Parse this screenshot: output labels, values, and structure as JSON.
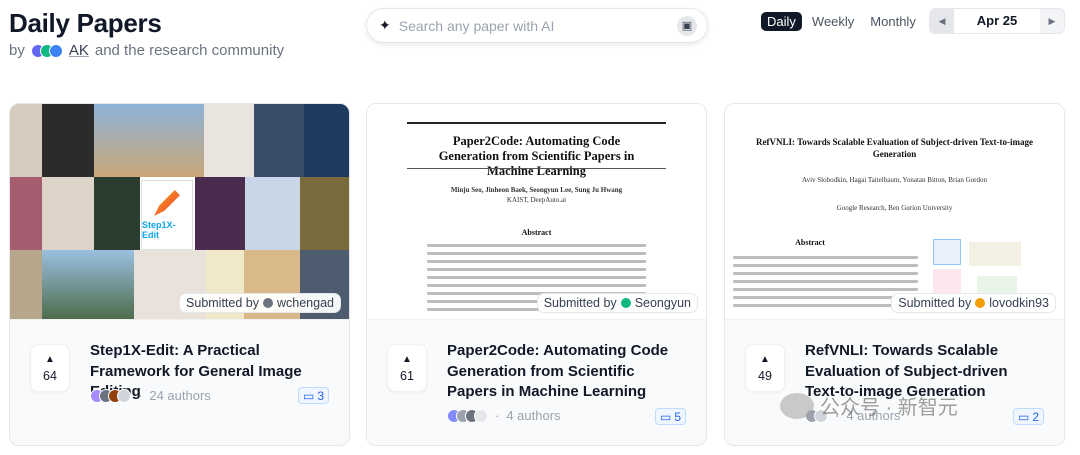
{
  "header": {
    "title": "Daily Papers",
    "by": "by",
    "ak": "AK",
    "community": "and the research community"
  },
  "search": {
    "placeholder": "Search any paper with AI"
  },
  "period": {
    "daily": "Daily",
    "weekly": "Weekly",
    "monthly": "Monthly",
    "active": "Daily"
  },
  "date_nav": {
    "date": "Apr 25"
  },
  "papers": [
    {
      "title": "Step1X-Edit: A Practical Framework for General Image Editing",
      "upvotes": "64",
      "authors": "24 authors",
      "comments": "3",
      "submitted_label": "Submitted by",
      "submitter": "wchengad",
      "thumb_logo_text": "Step1X-Edit"
    },
    {
      "title": "Paper2Code: Automating Code Generation from Scientific Papers in Machine Learning",
      "upvotes": "61",
      "authors": "4 authors",
      "comments": "5",
      "submitted_label": "Submitted by",
      "submitter": "Seongyun",
      "doc_title": "Paper2Code: Automating Code Generation from Scientific Papers in Machine Learning",
      "doc_authors": "Minju Seo, Jinheon Baek, Seongyun Lee, Sung Ju Hwang",
      "doc_affil": "KAIST, DeepAuto.ai",
      "doc_abstract": "Abstract"
    },
    {
      "title": "RefVNLI: Towards Scalable Evaluation of Subject-driven Text-to-image Generation",
      "upvotes": "49",
      "authors": "4 authors",
      "comments": "2",
      "submitted_label": "Submitted by",
      "submitter": "lovodkin93",
      "doc_title": "RefVNLI: Towards Scalable Evaluation of Subject-driven Text-to-image Generation",
      "doc_authors": "Aviv Slobodkin, Hagai Taitelbaum, Yonatan Bitton, Brian Gordon",
      "doc_affil": "Google Research, Ben Gurion University",
      "doc_abstract": "Abstract"
    }
  ],
  "watermark": {
    "text": "公众号 · 新智元"
  },
  "colors": {
    "accent": "#111827",
    "comment_blue": "#2563eb",
    "muted": "#9ca3af"
  }
}
